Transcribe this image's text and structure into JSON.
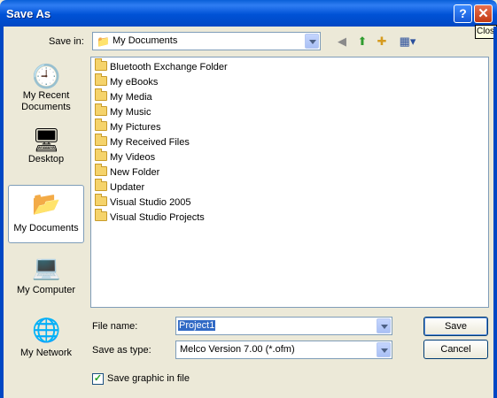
{
  "window": {
    "title": "Save As",
    "help_glyph": "?",
    "close_glyph": "✕",
    "tooltip": "Close"
  },
  "toolbar": {
    "save_in_label": "Save in:",
    "save_in_value": "My Documents",
    "icons": [
      "back-icon",
      "up-folder-icon",
      "new-folder-icon",
      "views-menu-icon"
    ]
  },
  "places": [
    {
      "label": "My Recent Documents",
      "icon": "recent-documents-icon",
      "glyph": "🕘"
    },
    {
      "label": "Desktop",
      "icon": "desktop-icon",
      "glyph": "🖥"
    },
    {
      "label": "My Documents",
      "icon": "my-documents-icon",
      "glyph": "📂",
      "selected": true
    },
    {
      "label": "My Computer",
      "icon": "my-computer-icon",
      "glyph": "💻"
    },
    {
      "label": "My Network",
      "icon": "network-icon",
      "glyph": "🌐"
    }
  ],
  "files": [
    {
      "name": "Bluetooth Exchange Folder"
    },
    {
      "name": "My eBooks"
    },
    {
      "name": "My Media"
    },
    {
      "name": "My Music"
    },
    {
      "name": "My Pictures"
    },
    {
      "name": "My Received Files"
    },
    {
      "name": "My Videos"
    },
    {
      "name": "New Folder"
    },
    {
      "name": "Updater"
    },
    {
      "name": "Visual Studio 2005"
    },
    {
      "name": "Visual Studio Projects"
    }
  ],
  "form": {
    "file_name_label": "File name:",
    "file_name_value": "Project1",
    "save_as_type_label": "Save as type:",
    "save_as_type_value": "Melco Version 7.00 (*.ofm)",
    "save_button": "Save",
    "cancel_button": "Cancel",
    "checkbox_label": "Save graphic in file",
    "checkbox_checked": true
  },
  "colors": {
    "titlebar": "#0052d6",
    "dialog_bg": "#ece9d8",
    "selection": "#316ac5"
  }
}
